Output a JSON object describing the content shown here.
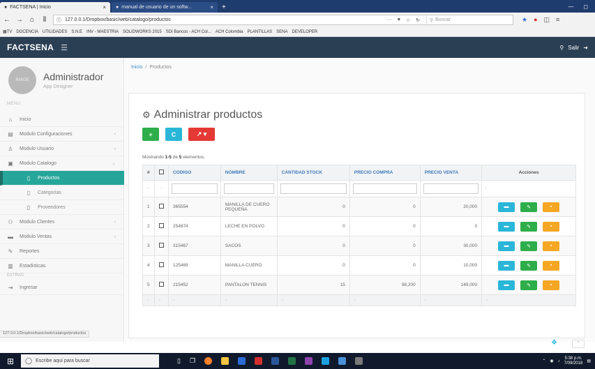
{
  "browser": {
    "tabs": [
      {
        "title": "FACTSENA | Inicio",
        "active": true
      },
      {
        "title": "manual de usuario de un softw..."
      }
    ],
    "url": "127.0.0.1/Dropbox/basic/web/catalogo/productos",
    "search_placeholder": "Buscar",
    "bookmarks": [
      "DOCENCIA",
      "UTILIDADES",
      "S.N.E",
      "INV - MAESTRIA",
      "SOLIDWORKS 2015",
      "SDI Bancos - ACH Col...",
      "ACH Colombia",
      "PLANTILLAS",
      "SENA",
      "DEVELOPER"
    ]
  },
  "app": {
    "brand": "FACTSENA",
    "logout_label": "Salir"
  },
  "sidebar": {
    "user_name": "Administrador",
    "user_role": "App Designer",
    "avatar_text": "IMAGE",
    "section_menu": "MENU",
    "section_extras": "EXTRAS",
    "items": [
      {
        "label": "Inicio"
      },
      {
        "label": "Modulo Configuraciones"
      },
      {
        "label": "Modulo Usuario"
      },
      {
        "label": "Modulo Catalogo"
      },
      {
        "label": "Productos"
      },
      {
        "label": "Categorias"
      },
      {
        "label": "Proveedores"
      },
      {
        "label": "Modulo Clientes"
      },
      {
        "label": "Modulo Ventas"
      },
      {
        "label": "Reportes"
      },
      {
        "label": "Estadisticas"
      },
      {
        "label": "Ingresar"
      }
    ]
  },
  "breadcrumb": {
    "home": "Inicio",
    "current": "Productos"
  },
  "panel": {
    "title": "Administrar productos",
    "add_label": "+",
    "refresh_label": "C",
    "export_label": "↗ ▾",
    "showing_prefix": "Mostrando",
    "showing_range": "1-5",
    "showing_mid": "de",
    "showing_total": "5",
    "showing_suffix": "elementos."
  },
  "table": {
    "headers": [
      "#",
      "CODIGO",
      "NOMBRE",
      "CANTIDAD STOCK",
      "PRECIO COMPRA",
      "PRECIO VENTA",
      "Acciones"
    ],
    "rows": [
      {
        "n": "1",
        "codigo": "365554",
        "nombre": "MANILLA DE CUERO PEQUEÑA",
        "stock": "0",
        "compra": "0",
        "venta": "20,000"
      },
      {
        "n": "2",
        "codigo": "254874",
        "nombre": "LECHE EN POLVO",
        "stock": "0",
        "compra": "0",
        "venta": "0"
      },
      {
        "n": "3",
        "codigo": "315467",
        "nombre": "SACOS",
        "stock": "0",
        "compra": "0",
        "venta": "30,000"
      },
      {
        "n": "4",
        "codigo": "125469",
        "nombre": "MANILLA CUERO",
        "stock": "0",
        "compra": "0",
        "venta": "10,000"
      },
      {
        "n": "5",
        "codigo": "215452",
        "nombre": "PANTALON TENNIS",
        "stock": "15",
        "compra": "98,200",
        "venta": "149,000"
      }
    ]
  },
  "status_url": "127.0.0.1/Dropbox/basic/web/catalogo/productos",
  "taskbar": {
    "search_placeholder": "Escribe aquí para buscar",
    "time": "5:38 p.m.",
    "date": "7/09/2018"
  },
  "colors": {
    "header_bg": "#2a3f54",
    "active_item": "#26a69a",
    "add_btn": "#2eae4a",
    "refresh_btn": "#29b6d8",
    "export_btn": "#e53935",
    "delete_btn": "#f5a623"
  }
}
